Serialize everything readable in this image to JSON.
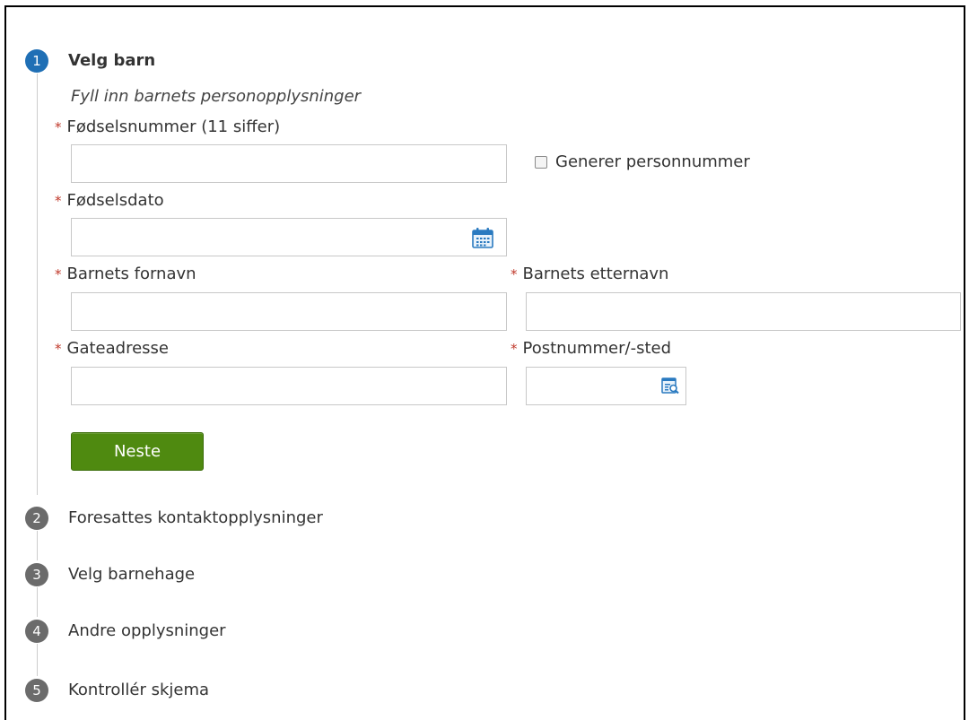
{
  "colors": {
    "active_step": "#1f6fb5",
    "inactive_step": "#6b6b6b",
    "required_marker": "#c0392b",
    "primary_button": "#4f8a10"
  },
  "steps": [
    {
      "number": "1",
      "title": "Velg barn",
      "state": "active"
    },
    {
      "number": "2",
      "title": "Foresattes kontaktopplysninger",
      "state": "inactive"
    },
    {
      "number": "3",
      "title": "Velg barnehage",
      "state": "inactive"
    },
    {
      "number": "4",
      "title": "Andre opplysninger",
      "state": "inactive"
    },
    {
      "number": "5",
      "title": "Kontrollér skjema",
      "state": "inactive"
    }
  ],
  "form": {
    "subtitle": "Fyll inn barnets personopplysninger",
    "required_marker": "*",
    "fields": {
      "birth_number": {
        "label": "Fødselsnummer (11 siffer)",
        "value": ""
      },
      "birth_date": {
        "label": "Fødselsdato",
        "value": "",
        "icon": "calendar-icon"
      },
      "first_name": {
        "label": "Barnets fornavn",
        "value": ""
      },
      "last_name": {
        "label": "Barnets etternavn",
        "value": ""
      },
      "street_address": {
        "label": "Gateadresse",
        "value": ""
      },
      "postal_code": {
        "label": "Postnummer/-sted",
        "value": "",
        "icon": "lookup-icon"
      }
    },
    "generate_checkbox": {
      "label": "Generer personnummer",
      "checked": false
    },
    "next_button": {
      "label": "Neste"
    }
  }
}
